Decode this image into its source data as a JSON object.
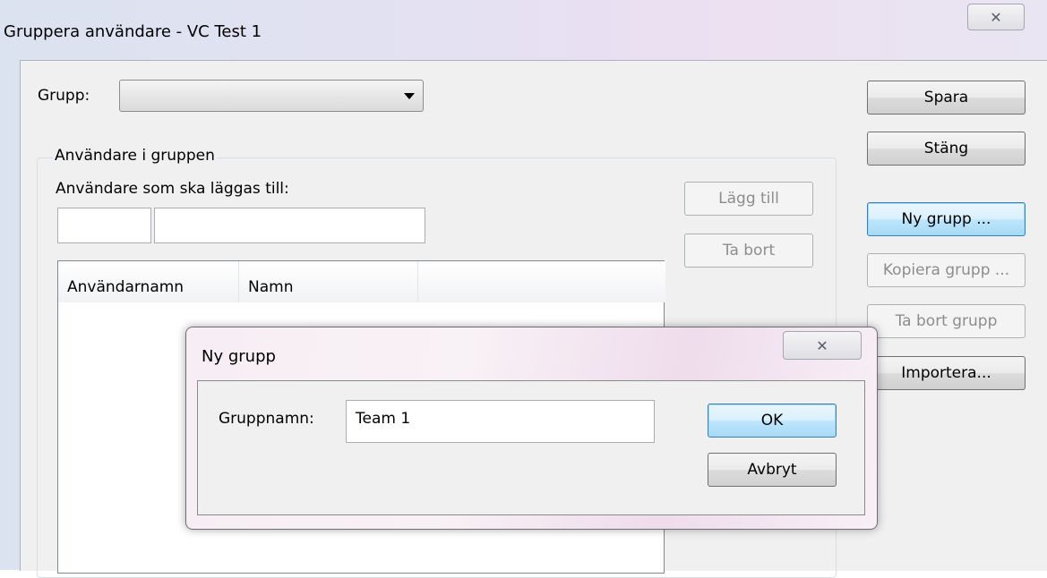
{
  "window": {
    "title": "Gruppera användare - VC Test 1",
    "close_glyph": "✕"
  },
  "form": {
    "group_label": "Grupp:",
    "group_value": ""
  },
  "buttons": {
    "save": "Spara",
    "close": "Stäng",
    "new_group": "Ny grupp ...",
    "copy_group": "Kopiera grupp ...",
    "delete_group": "Ta bort grupp",
    "import": "Importera...",
    "add": "Lägg till",
    "remove": "Ta bort"
  },
  "users_section": {
    "title": "Användare i gruppen",
    "add_label": "Användare som ska läggas till:",
    "username_value": "",
    "name_value": "",
    "columns": [
      "Användarnamn",
      "Namn"
    ]
  },
  "dialog": {
    "title": "Ny grupp",
    "close_glyph": "✕",
    "field_label": "Gruppnamn:",
    "field_value": "Team 1",
    "ok": "OK",
    "cancel": "Avbryt"
  }
}
